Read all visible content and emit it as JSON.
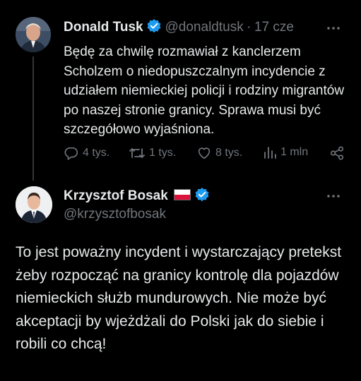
{
  "tweet1": {
    "author_name": "Donald Tusk",
    "handle": "@donaldtusk",
    "separator": "·",
    "date": "17 cze",
    "text": "Będę za chwilę rozmawiał z kanclerzem Scholzem o niedopuszczalnym incydencie z udziałem niemieckiej policji i rodziny migrantów po naszej stronie granicy. Sprawa musi być szczegółowo wyjaśniona.",
    "replies": "4 tys.",
    "reposts": "1 tys.",
    "likes": "8 tys.",
    "views": "1 mln"
  },
  "tweet2": {
    "author_name": "Krzysztof Bosak",
    "handle": "@krzysztofbosak",
    "text": "To jest poważny incydent i wystarczający pretekst żeby rozpocząć na granicy kontrolę dla pojazdów niemieckich służb mundurowych. Nie może być akceptacji by wjeżdżali do Polski jak do siebie i robili co chcą!"
  },
  "icons": {
    "verified": "verified-badge-icon",
    "reply": "reply-icon",
    "repost": "repost-icon",
    "like": "heart-icon",
    "views": "views-icon",
    "share": "share-icon",
    "more": "more-icon"
  },
  "colors": {
    "background": "#000000",
    "text": "#e7e9ea",
    "muted": "#71767b",
    "verified_blue": "#1d9bf0"
  }
}
